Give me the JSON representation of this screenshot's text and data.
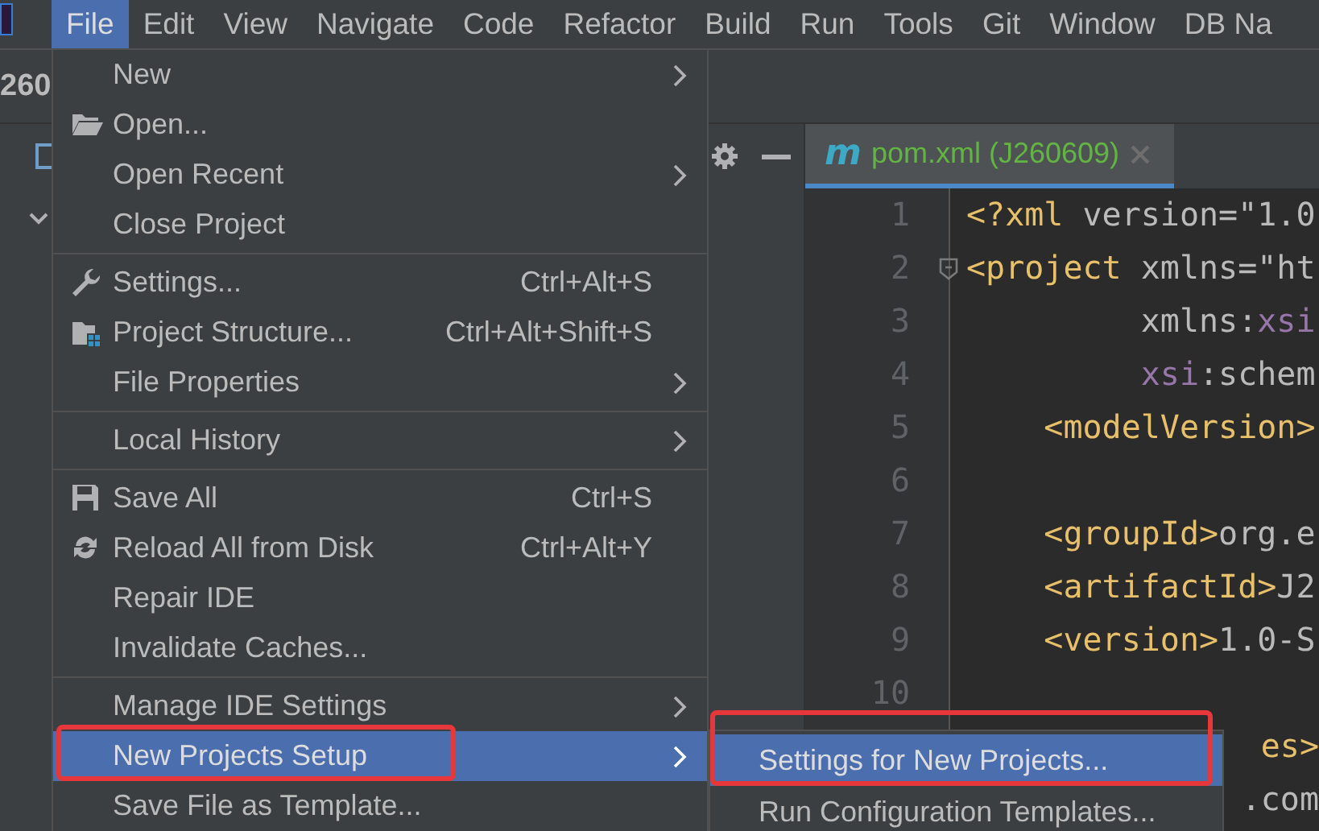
{
  "menubar": [
    {
      "label": "File",
      "selected": true
    },
    {
      "label": "Edit",
      "selected": false
    },
    {
      "label": "View",
      "selected": false
    },
    {
      "label": "Navigate",
      "selected": false
    },
    {
      "label": "Code",
      "selected": false
    },
    {
      "label": "Refactor",
      "selected": false
    },
    {
      "label": "Build",
      "selected": false
    },
    {
      "label": "Run",
      "selected": false
    },
    {
      "label": "Tools",
      "selected": false
    },
    {
      "label": "Git",
      "selected": false
    },
    {
      "label": "Window",
      "selected": false
    },
    {
      "label": "DB Na",
      "selected": false
    }
  ],
  "navbar": {
    "project_label": "260"
  },
  "editor": {
    "tab": {
      "glyph": "m",
      "title": "pom.xml (J260609)",
      "selected": true
    },
    "lines": [
      {
        "kind": "code",
        "number": "1",
        "foldable": false,
        "segments": [
          {
            "kind": "tag",
            "text": "<?xml"
          },
          {
            "kind": "plain",
            "text": " version=\"1.0"
          }
        ]
      },
      {
        "kind": "code",
        "number": "2",
        "foldable": true,
        "segments": [
          {
            "kind": "tag",
            "text": "<project"
          },
          {
            "kind": "plain",
            "text": " xmlns=\"ht"
          }
        ]
      },
      {
        "kind": "code",
        "number": "3",
        "foldable": false,
        "segments": [
          {
            "kind": "plain",
            "text": "         xmlns:"
          },
          {
            "kind": "ns",
            "text": "xsi"
          }
        ]
      },
      {
        "kind": "code",
        "number": "4",
        "foldable": false,
        "segments": [
          {
            "kind": "ns",
            "text": "         xsi"
          },
          {
            "kind": "plain",
            "text": ":schem"
          }
        ]
      },
      {
        "kind": "code",
        "number": "5",
        "foldable": false,
        "segments": [
          {
            "kind": "tag",
            "text": "    <modelVersion>"
          }
        ]
      },
      {
        "kind": "code",
        "number": "6",
        "foldable": false
      },
      {
        "kind": "code",
        "number": "7",
        "foldable": false,
        "segments": [
          {
            "kind": "tag",
            "text": "    <groupId>"
          },
          {
            "kind": "plain",
            "text": "org.e"
          }
        ]
      },
      {
        "kind": "code",
        "number": "8",
        "foldable": false,
        "segments": [
          {
            "kind": "tag",
            "text": "    <artifactId>"
          },
          {
            "kind": "plain",
            "text": "J2"
          }
        ]
      },
      {
        "kind": "code",
        "number": "9",
        "foldable": false,
        "segments": [
          {
            "kind": "tag",
            "text": "    <version>"
          },
          {
            "kind": "plain",
            "text": "1.0-S"
          }
        ]
      },
      {
        "kind": "code",
        "number": "10",
        "foldable": false
      },
      {
        "kind": "partial",
        "segments": [
          {
            "kind": "tag",
            "text": "es>"
          }
        ]
      },
      {
        "kind": "partial",
        "segments": [
          {
            "kind": "plain",
            "text": ".com"
          }
        ]
      }
    ]
  },
  "file_menu": {
    "items": [
      {
        "kind": "item",
        "label": "New",
        "submenu": true,
        "selected": false,
        "annotated": false
      },
      {
        "kind": "item",
        "label": "Open...",
        "submenu": false,
        "selected": false,
        "annotated": false
      },
      {
        "kind": "item",
        "label": "Open Recent",
        "submenu": true,
        "selected": false,
        "annotated": false
      },
      {
        "kind": "item",
        "label": "Close Project",
        "submenu": false,
        "selected": false,
        "annotated": false
      },
      {
        "kind": "separator"
      },
      {
        "kind": "item",
        "label": "Settings...",
        "shortcut": "Ctrl+Alt+S",
        "submenu": false,
        "selected": false,
        "annotated": false
      },
      {
        "kind": "item",
        "label": "Project Structure...",
        "shortcut": "Ctrl+Alt+Shift+S",
        "submenu": false,
        "selected": false,
        "annotated": false
      },
      {
        "kind": "item",
        "label": "File Properties",
        "submenu": true,
        "selected": false,
        "annotated": false
      },
      {
        "kind": "separator"
      },
      {
        "kind": "item",
        "label": "Local History",
        "submenu": true,
        "selected": false,
        "annotated": false
      },
      {
        "kind": "separator"
      },
      {
        "kind": "item",
        "label": "Save All",
        "shortcut": "Ctrl+S",
        "submenu": false,
        "selected": false,
        "annotated": false
      },
      {
        "kind": "item",
        "label": "Reload All from Disk",
        "shortcut": "Ctrl+Alt+Y",
        "submenu": false,
        "selected": false,
        "annotated": false
      },
      {
        "kind": "item",
        "label": "Repair IDE",
        "submenu": false,
        "selected": false,
        "annotated": false
      },
      {
        "kind": "item",
        "label": "Invalidate Caches...",
        "submenu": false,
        "selected": false,
        "annotated": false
      },
      {
        "kind": "separator"
      },
      {
        "kind": "item",
        "label": "Manage IDE Settings",
        "submenu": true,
        "selected": false,
        "annotated": false
      },
      {
        "kind": "item",
        "label": "New Projects Setup",
        "submenu": true,
        "selected": true,
        "annotated": true
      },
      {
        "kind": "item",
        "label": "Save File as Template...",
        "submenu": false,
        "selected": false,
        "annotated": false
      }
    ]
  },
  "submenu": {
    "items": [
      {
        "label": "Settings for New Projects...",
        "selected": true,
        "annotated": true
      },
      {
        "label": "Run Configuration Templates...",
        "selected": false,
        "annotated": false
      }
    ]
  }
}
